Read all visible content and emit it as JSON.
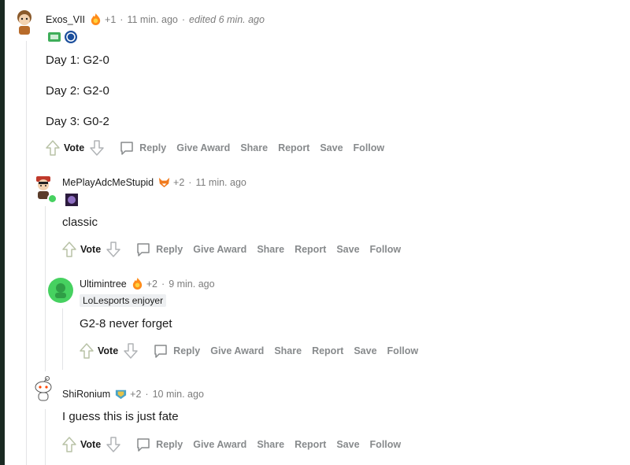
{
  "comments": [
    {
      "author": "Exos_VII",
      "karma": "+1",
      "time": "11 min. ago",
      "edited": "edited 6 min. ago",
      "body": [
        "Day 1: G2-0",
        "Day 2: G2-0",
        "Day 3: G0-2"
      ],
      "award_icon": "flame-award-icon",
      "flair_icons": [
        "team-flair-icon",
        "schalke-flair-icon"
      ]
    },
    {
      "author": "MePlayAdcMeStupid",
      "karma": "+2",
      "time": "11 min. ago",
      "body": [
        "classic"
      ],
      "award_icon": "fox-award-icon",
      "flair_icons": [
        "champion-flair-icon"
      ]
    },
    {
      "author": "Ultimintree",
      "karma": "+2",
      "time": "9 min. ago",
      "flair_text": "LoLesports enjoyer",
      "body": [
        "G2-8 never forget"
      ],
      "award_icon": "flame-award-icon"
    },
    {
      "author": "ShiRonium",
      "karma": "+2",
      "time": "10 min. ago",
      "body": [
        "I guess this is just fate"
      ],
      "award_icon": "badge-award-icon"
    }
  ],
  "actions": {
    "vote": "Vote",
    "reply": "Reply",
    "give_award": "Give Award",
    "share": "Share",
    "report": "Report",
    "save": "Save",
    "follow": "Follow"
  },
  "colors": {
    "action_text": "#878a8c",
    "thread_line": "#e3e4e6",
    "online_dot": "#46d160",
    "page_edge": "#1a2a22"
  }
}
